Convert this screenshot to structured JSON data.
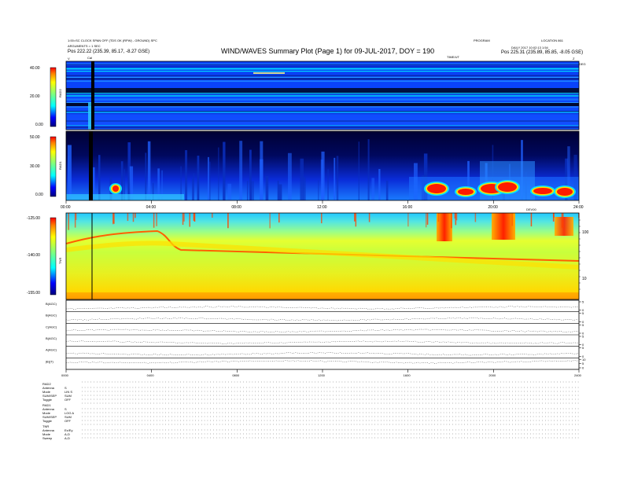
{
  "header": {
    "left_line1": "1:00=SC CLOCK SPAN OFF  (TDS OK (RPW) - GROUND) SPC",
    "left_line2": "ARGUMENTS = 1 SEC",
    "left_pos_label": "Pos",
    "left_pos_value": "222.22 (235.39, 85.17, -8.27 GSE)",
    "title": "WIND/WAVES Summary Plot (Page 1) for 09-JUL-2017, DOY = 190",
    "right_line1": "PROGRAM",
    "right_line2": "DAILY 2017 10:02:13 1:54",
    "right_id": "LOCATION 861",
    "right_pos_label": "Pos",
    "right_pos_value": "225.31 (235.89, 85.85, -8.05 GSE)",
    "cal_label": "Cal",
    "time_label": "TIME/UT",
    "axis_v": "V",
    "axis_z": "Z",
    "axis_deg": "DEG"
  },
  "chart_data": [
    {
      "type": "heatmap",
      "panel": "RAD2",
      "ylabel": "RAD2",
      "colorbar_ticks": [
        "40.00",
        "20.00",
        "0.00"
      ],
      "ylim": [
        0,
        40
      ]
    },
    {
      "type": "heatmap",
      "panel": "RAD1",
      "ylabel": "RAD1",
      "colorbar_ticks": [
        "50.00",
        "30.00",
        "0.00"
      ],
      "ylim": [
        0,
        50
      ],
      "x_ticks": [
        "00:00",
        "04:00",
        "08:00",
        "12:00",
        "16:00",
        "20:00",
        "24:00"
      ],
      "xlim": [
        0,
        24
      ]
    },
    {
      "type": "heatmap",
      "panel": "TNR",
      "ylabel": "TNR",
      "colorbar_ticks": [
        "-125.00",
        "-140.00",
        "-155.00"
      ],
      "ylim": [
        -155,
        -125
      ],
      "right_axis_ticks": [
        "100",
        "10"
      ],
      "right_axis_top": "DEV00"
    },
    {
      "type": "line",
      "panel": "magnetic-field",
      "rows": [
        "B(AGC)",
        "B(AGC)",
        "C(AGC)",
        "B(AGC)",
        "A(AGC)",
        "|B|(T)"
      ],
      "row_ticks": [
        [
          "0",
          "5"
        ],
        [
          "0",
          "5"
        ],
        [
          "0",
          "5"
        ],
        [
          "0",
          "5"
        ],
        [
          "0",
          "5"
        ],
        [
          "0",
          "5",
          "10"
        ]
      ],
      "x_ticks": [
        "0000",
        "0400",
        "0800",
        "1200",
        "1600",
        "2000",
        "2400"
      ],
      "xlim": [
        0,
        24
      ]
    }
  ],
  "footer": {
    "rad2_header": "RAD2",
    "rad1_header": "RAD1",
    "tnr_header": "TNR",
    "rad2_rows": [
      {
        "label": "Antenna",
        "value": "S"
      },
      {
        "label": "Mode",
        "value": "LIN S"
      },
      {
        "label": "SUM/SEP",
        "value": "SUM"
      },
      {
        "label": "Toggle",
        "value": "OFF"
      }
    ],
    "rad1_rows": [
      {
        "label": "Antenna",
        "value": "S"
      },
      {
        "label": "Mode",
        "value": "LOG A"
      },
      {
        "label": "SUM/SEP",
        "value": "SUM"
      },
      {
        "label": "Toggle",
        "value": "OFF"
      }
    ],
    "tnr_rows": [
      {
        "label": "Antenna",
        "value": "Ex/Ey"
      },
      {
        "label": "Mode",
        "value": "A-D"
      },
      {
        "label": "Sweep",
        "value": "A-D"
      }
    ]
  }
}
